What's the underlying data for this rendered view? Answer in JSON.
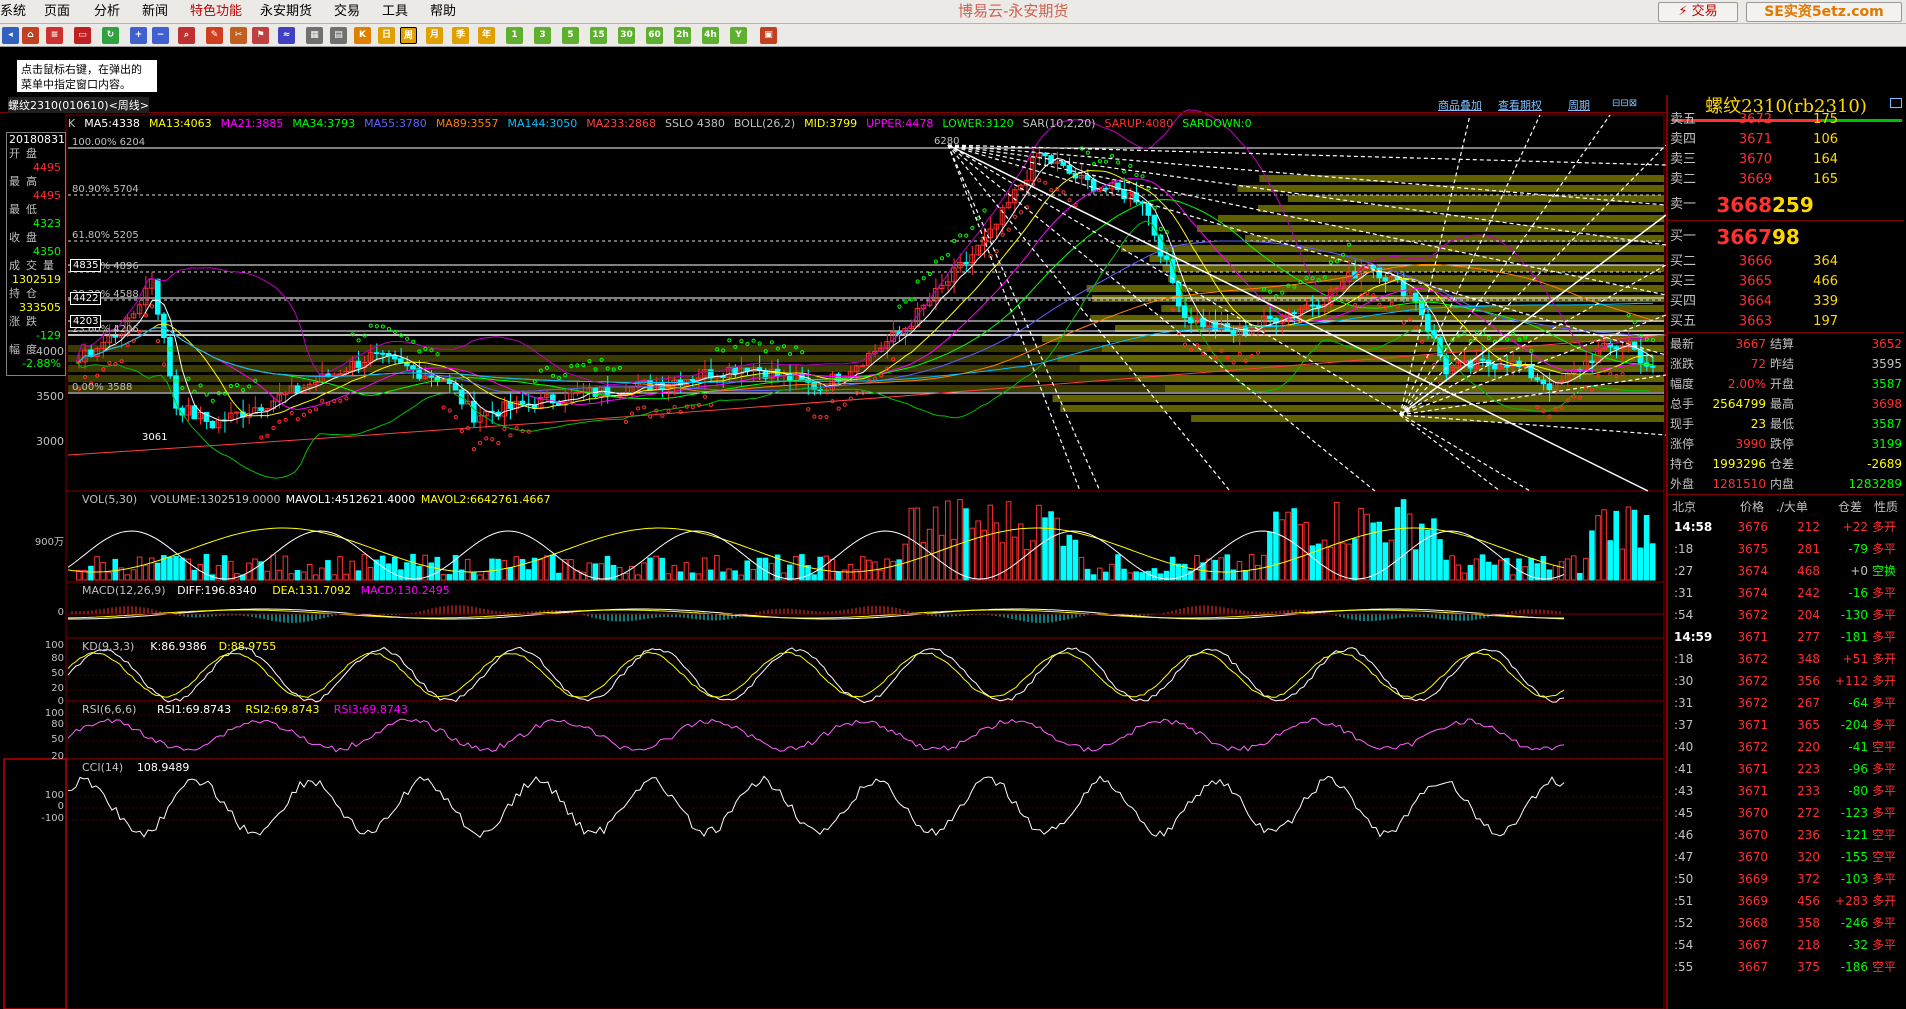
{
  "menu": {
    "items": [
      "系统",
      "页面",
      "分析",
      "新闻",
      "特色功能",
      "永安期货",
      "交易",
      "工具",
      "帮助"
    ],
    "selected": "特色功能"
  },
  "app_title": "博易云-永安期货",
  "trade_button": "⚡ 交易",
  "site_badge": "SE实资5etz.com",
  "toolbar_labels": [
    "1",
    "3",
    "5",
    "15",
    "30",
    "60",
    "2h",
    "4h",
    "Y"
  ],
  "tooltip": [
    "点击鼠标右键，在弹出的",
    "菜单中指定窗口内容。"
  ],
  "header": {
    "instrument": "螺纹2310(010610)<周线>",
    "links": [
      "商品叠加",
      "查看期权",
      "周期"
    ]
  },
  "main_indicators": [
    {
      "t": "K",
      "c": "#c0c0c0"
    },
    {
      "t": "MA5:4338",
      "c": "#ffffff"
    },
    {
      "t": "MA13:4063",
      "c": "#ffff00"
    },
    {
      "t": "MA21:3885",
      "c": "#ff00ff"
    },
    {
      "t": "MA34:3793",
      "c": "#00ff00"
    },
    {
      "t": "MA55:3780",
      "c": "#6060ff"
    },
    {
      "t": "MA89:3557",
      "c": "#ff8000"
    },
    {
      "t": "MA144:3050",
      "c": "#00c0ff"
    },
    {
      "t": "MA233:2868",
      "c": "#ff4040"
    },
    {
      "t": "SSLO 4380",
      "c": "#c0c0c0"
    },
    {
      "t": "BOLL(26,2)",
      "c": "#c0c0c0"
    },
    {
      "t": "MID:3799",
      "c": "#ffff00"
    },
    {
      "t": "UPPER:4478",
      "c": "#ff00ff"
    },
    {
      "t": "LOWER:3120",
      "c": "#00ff00"
    },
    {
      "t": "SAR(10,2,20)",
      "c": "#c0c0c0"
    },
    {
      "t": "SARUP:4080",
      "c": "#ff3030"
    },
    {
      "t": "SARDOWN:0",
      "c": "#00ff00"
    }
  ],
  "fib_labels": [
    "100.00% 6204",
    "80.90% 5704",
    "61.80% 5205",
    "50.00% 4896",
    "38.20% 4588",
    "23.60% 4206",
    "0.00% 3588"
  ],
  "price_marks": [
    "6280",
    "4835",
    "4422",
    "4203",
    "3061"
  ],
  "price_axis": [
    "4000",
    "3500",
    "3000"
  ],
  "data_box": {
    "date": "20180831",
    "rows": [
      {
        "k": "开盘",
        "v": "4495",
        "c": "#ff3030"
      },
      {
        "k": "最高",
        "v": "4495",
        "c": "#ff3030"
      },
      {
        "k": "最低",
        "v": "4323",
        "c": "#00ff00"
      },
      {
        "k": "收盘",
        "v": "4350",
        "c": "#00ff00"
      },
      {
        "k": "成交量",
        "v": "1302519",
        "c": "#ffff00"
      },
      {
        "k": "持仓",
        "v": "333505",
        "c": "#ffff00"
      },
      {
        "k": "涨跌",
        "v": "-129",
        "c": "#00ff00"
      },
      {
        "k": "幅度",
        "v": "-2.88%",
        "c": "#00ff00"
      }
    ]
  },
  "vol_panel": {
    "title": [
      {
        "t": "VOL(5,30)",
        "c": "#c0c0c0"
      },
      {
        "t": "VOLUME:1302519.0000",
        "c": "#c0c0c0"
      },
      {
        "t": "MAVOL1:4512621.4000",
        "c": "#ffffff"
      },
      {
        "t": "MAVOL2:6642761.4667",
        "c": "#ffff00"
      }
    ],
    "axis": [
      "900万"
    ]
  },
  "macd_panel": {
    "title": [
      {
        "t": "MACD(12,26,9)",
        "c": "#c0c0c0"
      },
      {
        "t": "DIFF:196.8340",
        "c": "#ffffff"
      },
      {
        "t": "DEA:131.7092",
        "c": "#ffff00"
      },
      {
        "t": "MACD:130.2495",
        "c": "#ff00ff"
      }
    ],
    "axis": [
      "0"
    ]
  },
  "kd_panel": {
    "title": [
      {
        "t": "KD(9,3,3)",
        "c": "#c0c0c0"
      },
      {
        "t": "K:86.9386",
        "c": "#ffffff"
      },
      {
        "t": "D:88.9755",
        "c": "#ffff00"
      }
    ],
    "axis": [
      "100",
      "80",
      "50",
      "20",
      "0"
    ]
  },
  "rsi_panel": {
    "title": [
      {
        "t": "RSI(6,6,6)",
        "c": "#c0c0c0"
      },
      {
        "t": "RSI1:69.8743",
        "c": "#ffffff"
      },
      {
        "t": "RSI2:69.8743",
        "c": "#ffff00"
      },
      {
        "t": "RSI3:69.8743",
        "c": "#ff00ff"
      }
    ],
    "axis": [
      "100",
      "80",
      "50",
      "20"
    ]
  },
  "cci_panel": {
    "title": [
      {
        "t": "CCI(14)",
        "c": "#c0c0c0"
      },
      {
        "t": "108.9489",
        "c": "#ffffff"
      }
    ],
    "axis": [
      "100",
      "0",
      "-100"
    ]
  },
  "quote": {
    "title": "螺纹2310(rb2310)",
    "asks": [
      {
        "label": "卖五",
        "price": "3672",
        "vol": "175"
      },
      {
        "label": "卖四",
        "price": "3671",
        "vol": "106"
      },
      {
        "label": "卖三",
        "price": "3670",
        "vol": "164"
      },
      {
        "label": "卖二",
        "price": "3669",
        "vol": "165"
      },
      {
        "label": "卖一",
        "price": "3668",
        "vol": "259"
      }
    ],
    "bids": [
      {
        "label": "买一",
        "price": "3667",
        "vol": "98"
      },
      {
        "label": "买二",
        "price": "3666",
        "vol": "364"
      },
      {
        "label": "买三",
        "price": "3665",
        "vol": "466"
      },
      {
        "label": "买四",
        "price": "3664",
        "vol": "339"
      },
      {
        "label": "买五",
        "price": "3663",
        "vol": "197"
      }
    ],
    "stats": [
      {
        "l": "最新",
        "a": "3667",
        "ac": "#ff3030",
        "l2": "结算",
        "b": "3652",
        "bc": "#ff3030"
      },
      {
        "l": "涨跌",
        "a": "72",
        "ac": "#ff3030",
        "l2": "昨结",
        "b": "3595",
        "bc": "#c0c0c0"
      },
      {
        "l": "幅度",
        "a": "2.00%",
        "ac": "#ff3030",
        "l2": "开盘",
        "b": "3587",
        "bc": "#00ff00"
      },
      {
        "l": "总手",
        "a": "2564799",
        "ac": "#ffff00",
        "l2": "最高",
        "b": "3698",
        "bc": "#ff3030"
      },
      {
        "l": "现手",
        "a": "23",
        "ac": "#ffff00",
        "l2": "最低",
        "b": "3587",
        "bc": "#00ff00"
      },
      {
        "l": "涨停",
        "a": "3990",
        "ac": "#ff3030",
        "l2": "跌停",
        "b": "3199",
        "bc": "#00ff00"
      },
      {
        "l": "持仓",
        "a": "1993296",
        "ac": "#ffff00",
        "l2": "仓差",
        "b": "-2689",
        "bc": "#ffff00"
      },
      {
        "l": "外盘",
        "a": "1281510",
        "ac": "#ff3030",
        "l2": "内盘",
        "b": "1283289",
        "bc": "#00ff00"
      }
    ],
    "ticks_header": [
      "北京",
      "价格",
      "./大单",
      "仓差",
      "性质"
    ],
    "ticks": [
      {
        "t": "14:58",
        "p": "3676",
        "q": "212",
        "d": "+22",
        "dc": "#ff3030",
        "n": "多开"
      },
      {
        "t": ":18",
        "p": "3675",
        "q": "281",
        "d": "-79",
        "dc": "#00ff00",
        "n": "多平"
      },
      {
        "t": ":27",
        "p": "3674",
        "q": "468",
        "d": "+0",
        "dc": "#c0c0c0",
        "n": "空换"
      },
      {
        "t": ":31",
        "p": "3674",
        "q": "242",
        "d": "-16",
        "dc": "#00ff00",
        "n": "多平"
      },
      {
        "t": ":54",
        "p": "3672",
        "q": "204",
        "d": "-130",
        "dc": "#00ff00",
        "n": "多平"
      },
      {
        "t": "14:59",
        "p": "3671",
        "q": "277",
        "d": "-181",
        "dc": "#00ff00",
        "n": "多平"
      },
      {
        "t": ":18",
        "p": "3672",
        "q": "348",
        "d": "+51",
        "dc": "#ff3030",
        "n": "多开"
      },
      {
        "t": ":30",
        "p": "3672",
        "q": "356",
        "d": "+112",
        "dc": "#ff3030",
        "n": "多开"
      },
      {
        "t": ":31",
        "p": "3672",
        "q": "267",
        "d": "-64",
        "dc": "#00ff00",
        "n": "多平"
      },
      {
        "t": ":37",
        "p": "3671",
        "q": "365",
        "d": "-204",
        "dc": "#00ff00",
        "n": "多平"
      },
      {
        "t": ":40",
        "p": "3672",
        "q": "220",
        "d": "-41",
        "dc": "#00ff00",
        "n": "空平"
      },
      {
        "t": ":41",
        "p": "3671",
        "q": "223",
        "d": "-96",
        "dc": "#00ff00",
        "n": "多平"
      },
      {
        "t": ":43",
        "p": "3671",
        "q": "233",
        "d": "-80",
        "dc": "#00ff00",
        "n": "多平"
      },
      {
        "t": ":45",
        "p": "3670",
        "q": "272",
        "d": "-123",
        "dc": "#00ff00",
        "n": "多平"
      },
      {
        "t": ":46",
        "p": "3670",
        "q": "236",
        "d": "-121",
        "dc": "#00ff00",
        "n": "空平"
      },
      {
        "t": ":47",
        "p": "3670",
        "q": "320",
        "d": "-155",
        "dc": "#00ff00",
        "n": "空平"
      },
      {
        "t": ":50",
        "p": "3669",
        "q": "372",
        "d": "-103",
        "dc": "#00ff00",
        "n": "多平"
      },
      {
        "t": ":51",
        "p": "3669",
        "q": "456",
        "d": "+283",
        "dc": "#ff3030",
        "n": "多开"
      },
      {
        "t": ":52",
        "p": "3668",
        "q": "358",
        "d": "-246",
        "dc": "#00ff00",
        "n": "多平"
      },
      {
        "t": ":54",
        "p": "3667",
        "q": "218",
        "d": "-32",
        "dc": "#00ff00",
        "n": "多平"
      },
      {
        "t": ":55",
        "p": "3667",
        "q": "375",
        "d": "-186",
        "dc": "#00ff00",
        "n": "空平"
      }
    ]
  },
  "colors": {
    "up": "#ff3030",
    "down": "#00ffff",
    "frame": "#800000",
    "accent": "#ffd800"
  },
  "chart_data": {
    "type": "candlestick",
    "interval": "weekly",
    "price_scale": {
      "ticks": [
        3000,
        3500,
        4000
      ],
      "fib_high": 6204,
      "fib_low": 3588
    }
  }
}
